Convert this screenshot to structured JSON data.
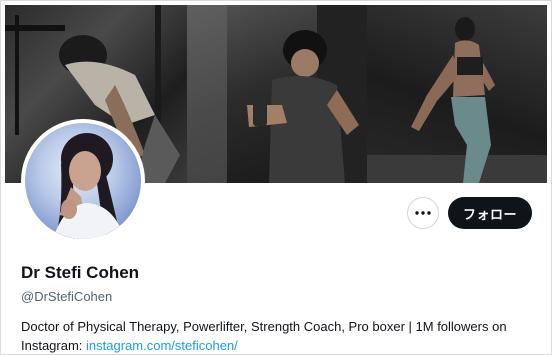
{
  "banner": {
    "photos": [
      {
        "icon": "gym-photo-lifting"
      },
      {
        "icon": "gym-photo-shaker"
      },
      {
        "icon": "gym-photo-pose"
      }
    ]
  },
  "profile": {
    "avatar_icon": "profile-photo",
    "name": "Dr Stefi Cohen",
    "handle": "@DrStefiCohen",
    "bio_text": "Doctor of Physical Therapy, Powerlifter, Strength Coach, Pro boxer | 1M followers on Instagram: ",
    "bio_link": "instagram.com/steficohen/"
  },
  "actions": {
    "more_icon": "more-dots-icon",
    "follow_label": "フォロー"
  },
  "colors": {
    "link": "#1d9bf0",
    "follow_bg": "#0f1419",
    "handle": "#536471"
  }
}
